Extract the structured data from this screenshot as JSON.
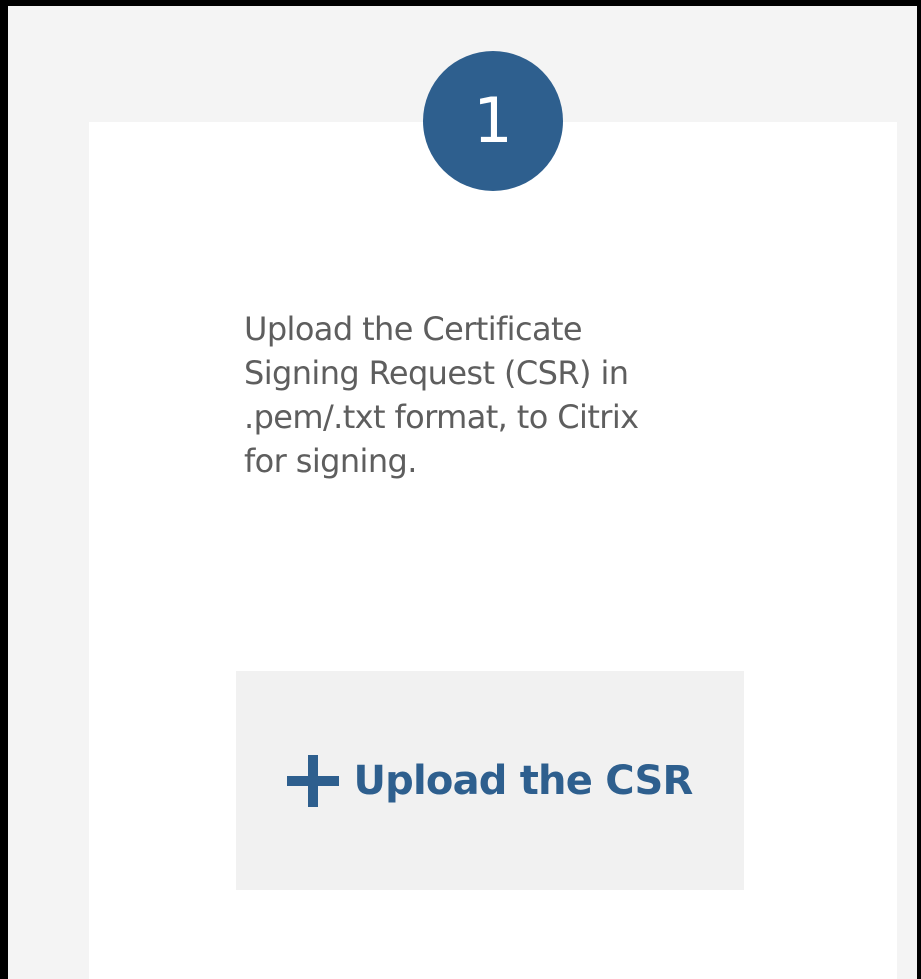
{
  "step": {
    "number": "1"
  },
  "description": "Upload the Certificate\nSigning Request (CSR) in\n.pem/.txt format, to Citrix\nfor signing.",
  "upload_button": {
    "icon": "plus-icon",
    "label": "Upload the CSR"
  },
  "colors": {
    "accent": "#2e5f8e",
    "text": "#5e5e5e",
    "background": "#f4f4f4",
    "card": "#ffffff",
    "button_bg": "#f1f1f1"
  }
}
